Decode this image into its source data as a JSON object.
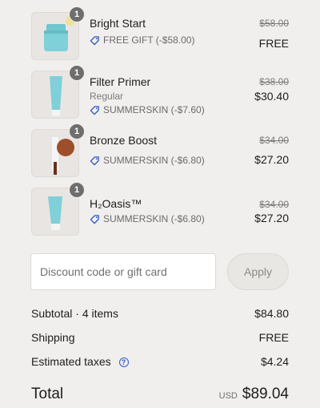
{
  "line_items": [
    {
      "name": "Bright Start",
      "quantity": "1",
      "variant": "",
      "discount_label": "FREE GIFT (-$58.00)",
      "original_price": "$58.00",
      "final_price": "FREE",
      "product": "jar"
    },
    {
      "name": "Filter Primer",
      "quantity": "1",
      "variant": "Regular",
      "discount_label": "SUMMERSKIN (-$7.60)",
      "original_price": "$38.00",
      "final_price": "$30.40",
      "product": "tube"
    },
    {
      "name": "Bronze Boost",
      "quantity": "1",
      "variant": "",
      "discount_label": "SUMMERSKIN (-$6.80)",
      "original_price": "$34.00",
      "final_price": "$27.20",
      "product": "dropper"
    },
    {
      "name": "H₂Oasis™",
      "quantity": "1",
      "variant": "",
      "discount_label": "SUMMERSKIN (-$6.80)",
      "original_price": "$34.00",
      "final_price": "$27.20",
      "product": "tube-short"
    }
  ],
  "discount": {
    "placeholder": "Discount code or gift card",
    "apply_label": "Apply"
  },
  "summary": {
    "subtotal_label": "Subtotal · 4 items",
    "subtotal_value": "$84.80",
    "shipping_label": "Shipping",
    "shipping_value": "FREE",
    "taxes_label": "Estimated taxes",
    "taxes_value": "$4.24",
    "total_label": "Total",
    "currency": "USD",
    "total_value": "$89.04"
  },
  "colors": {
    "background": "#f1efed",
    "tag_icon": "#2e59c6",
    "product_teal": "#7fd0d8"
  },
  "icons": {
    "tag": "tag-icon",
    "help": "question-circle-icon"
  }
}
